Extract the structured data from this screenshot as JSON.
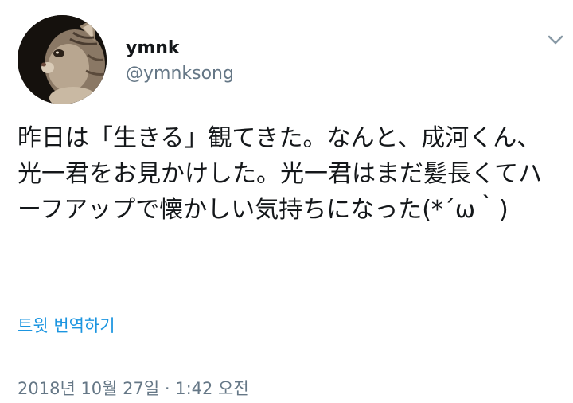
{
  "user": {
    "display_name": "ymnk",
    "handle": "@ymnksong"
  },
  "tweet": {
    "text": "昨日は「生きる」観てきた。なんと、成河くん、光一君をお見かけした。光一君はまだ髪長くてハーフアップで懐かしい気持ちになった(*´ω｀)",
    "translate_label": "트윗 번역하기",
    "timestamp": "2018년 10월 27일 · 1:42 오전"
  },
  "icons": {
    "caret": "chevron-down-icon",
    "avatar": "cat-avatar"
  },
  "colors": {
    "text": "#14171a",
    "secondary": "#657786",
    "link": "#1b95e0"
  }
}
